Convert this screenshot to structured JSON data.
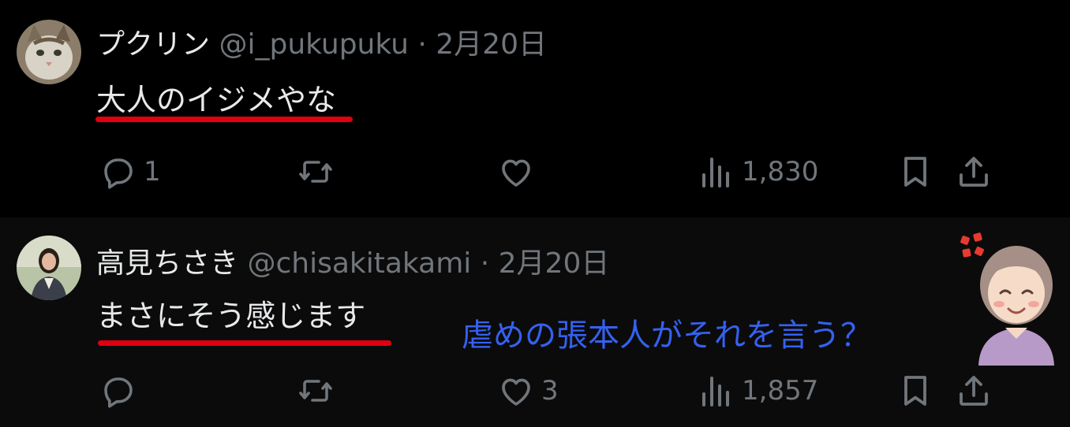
{
  "posts": [
    {
      "name": "プクリン",
      "handle": "@i_pukupuku",
      "separator": "·",
      "date": "2月20日",
      "text": "大人のイジメやな",
      "replies": "1",
      "retweets": "",
      "likes": "",
      "views": "1,830"
    },
    {
      "name": "高見ちさき",
      "handle": "@chisakitakami",
      "separator": "·",
      "date": "2月20日",
      "text": "まさにそう感じます",
      "replies": "",
      "retweets": "",
      "likes": "3",
      "views": "1,857"
    }
  ],
  "overlay": {
    "comment": "虐めの張本人がそれを言う？"
  },
  "colors": {
    "background": "#000000",
    "text": "#e7e9ea",
    "muted": "#71767b",
    "underline": "#e00010",
    "overlay_text": "#3461f0"
  },
  "icons": [
    "reply-icon",
    "retweet-icon",
    "like-icon",
    "views-icon",
    "bookmark-icon",
    "share-icon"
  ]
}
